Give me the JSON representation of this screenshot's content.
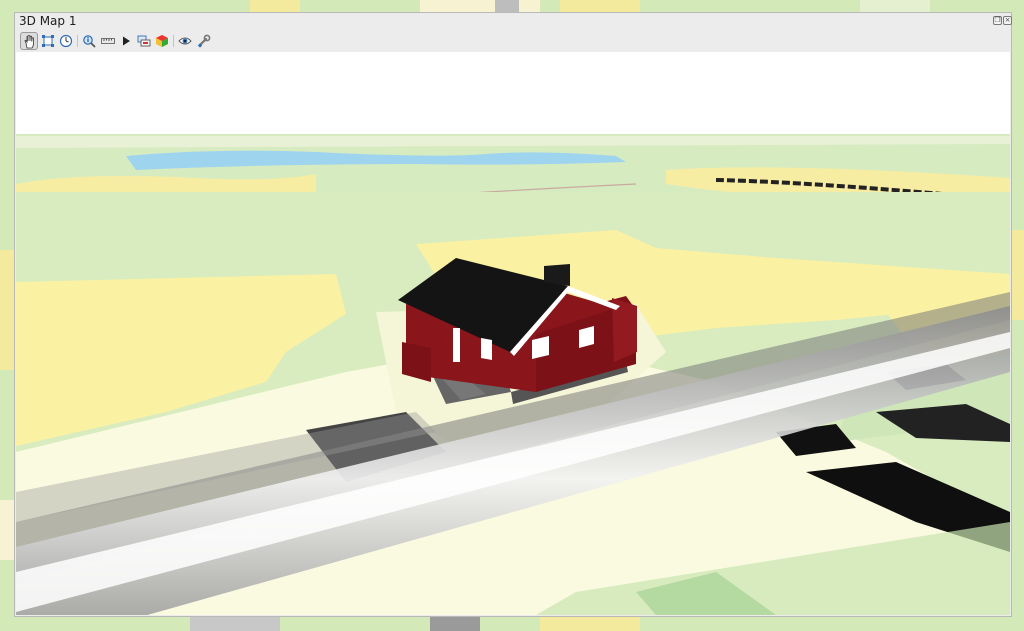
{
  "window": {
    "title": "3D Map 1",
    "restore_icon": "restore-icon",
    "close_icon": "close-icon"
  },
  "toolbar": {
    "tools": [
      {
        "name": "pan-tool",
        "icon": "hand-icon",
        "active": true
      },
      {
        "name": "zoom-full-tool",
        "icon": "zoom-full-icon",
        "active": false
      },
      {
        "name": "camera-rotate-tool",
        "icon": "compass-icon",
        "active": false
      },
      {
        "name": "identify-tool",
        "icon": "identify-icon",
        "active": false
      },
      {
        "name": "measure-tool",
        "icon": "measure-ruler-icon",
        "active": false
      },
      {
        "name": "animation-tool",
        "icon": "play-icon",
        "active": false
      },
      {
        "name": "export-tool",
        "icon": "export-layers-icon",
        "active": false
      },
      {
        "name": "map-themes-tool",
        "icon": "map-themes-icon",
        "active": false
      },
      {
        "name": "camera-view-tool",
        "icon": "eye-icon",
        "active": false
      },
      {
        "name": "settings-tool",
        "icon": "wrench-icon",
        "active": false
      }
    ]
  },
  "colors": {
    "terrain_green": "#d6ecbc",
    "terrain_yellow": "#fbf0a0",
    "terrain_cream": "#fbfbe0",
    "water_blue": "#9dd6f2",
    "house_red": "#8a141a",
    "roof_black": "#161616",
    "road_gray": "#8a8a8a"
  }
}
